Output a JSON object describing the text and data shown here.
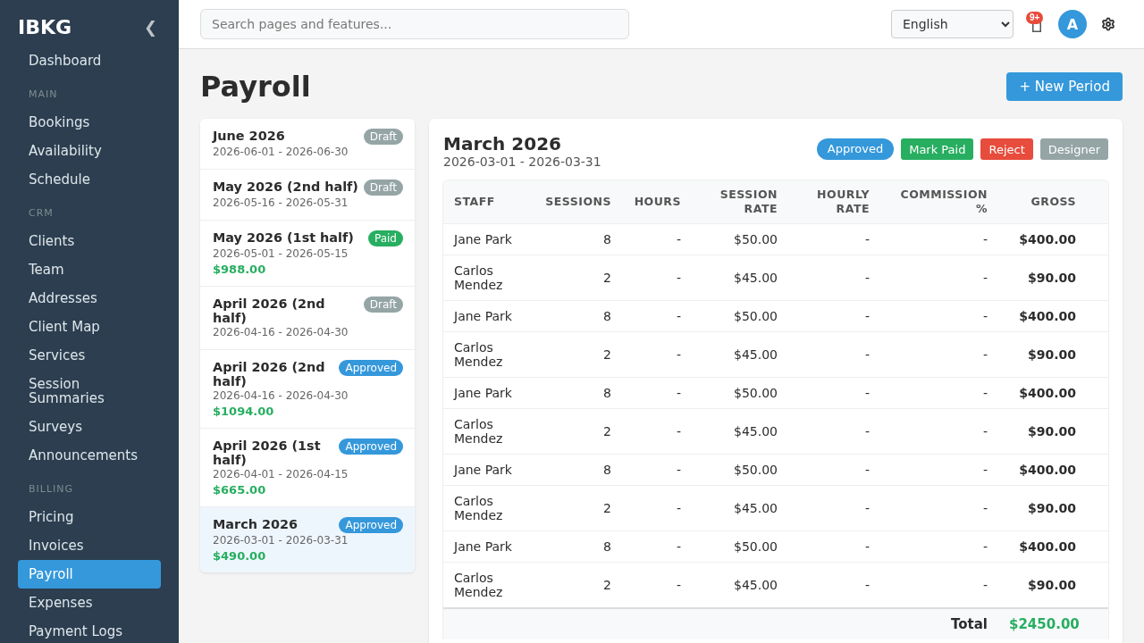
{
  "sidebar": {
    "logo": "IBKG",
    "collapse": "❮",
    "items": [
      {
        "kind": "link",
        "label": "Dashboard",
        "selected": false
      },
      {
        "kind": "section",
        "label": "MAIN"
      },
      {
        "kind": "link",
        "label": "Bookings",
        "selected": false
      },
      {
        "kind": "link",
        "label": "Availability",
        "selected": false
      },
      {
        "kind": "link",
        "label": "Schedule",
        "selected": false
      },
      {
        "kind": "section",
        "label": "CRM"
      },
      {
        "kind": "link",
        "label": "Clients",
        "selected": false
      },
      {
        "kind": "link",
        "label": "Team",
        "selected": false
      },
      {
        "kind": "link",
        "label": "Addresses",
        "selected": false
      },
      {
        "kind": "link",
        "label": "Client Map",
        "selected": false
      },
      {
        "kind": "link",
        "label": "Services",
        "selected": false
      },
      {
        "kind": "link",
        "label": "Session Summaries",
        "selected": false
      },
      {
        "kind": "link",
        "label": "Surveys",
        "selected": false
      },
      {
        "kind": "link",
        "label": "Announcements",
        "selected": false
      },
      {
        "kind": "section",
        "label": "BILLING"
      },
      {
        "kind": "link",
        "label": "Pricing",
        "selected": false
      },
      {
        "kind": "link",
        "label": "Invoices",
        "selected": false
      },
      {
        "kind": "link",
        "label": "Payroll",
        "selected": true
      },
      {
        "kind": "link",
        "label": "Expenses",
        "selected": false
      },
      {
        "kind": "link",
        "label": "Payment Logs",
        "selected": false
      }
    ]
  },
  "topbar": {
    "search": {
      "placeholder": "Search pages and features..."
    },
    "language": "English",
    "notifications": "9+",
    "avatar": "A"
  },
  "page": {
    "title": "Payroll",
    "new_button": "+ New Period"
  },
  "periods": [
    {
      "title": "June 2026",
      "dates": "2026-06-01 - 2026-06-30",
      "badge": {
        "label": "Draft",
        "color": "#95a5a6"
      },
      "selected": false
    },
    {
      "title": "May 2026 (2nd half)",
      "dates": "2026-05-16 - 2026-05-31",
      "badge": {
        "label": "Draft",
        "color": "#95a5a6"
      },
      "selected": false
    },
    {
      "title": "May 2026 (1st half)",
      "dates": "2026-05-01 - 2026-05-15",
      "badge": {
        "label": "Paid",
        "color": "#27ae60"
      },
      "amount": "$988.00",
      "selected": false
    },
    {
      "title": "April 2026 (2nd half)",
      "dates": "2026-04-16 - 2026-04-30",
      "badge": {
        "label": "Draft",
        "color": "#95a5a6"
      },
      "selected": false
    },
    {
      "title": "April 2026 (2nd half)",
      "dates": "2026-04-16 - 2026-04-30",
      "badge": {
        "label": "Approved",
        "color": "#3498db"
      },
      "amount": "$1094.00",
      "selected": false
    },
    {
      "title": "April 2026 (1st half)",
      "dates": "2026-04-01 - 2026-04-15",
      "badge": {
        "label": "Approved",
        "color": "#3498db"
      },
      "amount": "$665.00",
      "selected": false
    },
    {
      "title": "March 2026",
      "dates": "2026-03-01 - 2026-03-31",
      "badge": {
        "label": "Approved",
        "color": "#3498db"
      },
      "amount": "$490.00",
      "selected": true
    }
  ],
  "detail": {
    "title": "March 2026",
    "dates": "2026-03-01 - 2026-03-31",
    "badge": {
      "label": "Approved",
      "color": "#3498db"
    },
    "actions": [
      {
        "label": "Mark Paid",
        "kind": "success"
      },
      {
        "label": "Reject",
        "kind": "danger"
      },
      {
        "label": "Designer",
        "kind": "secondary"
      }
    ],
    "table": {
      "columns": [
        "STAFF",
        "SESSIONS",
        "HOURS",
        "SESSION RATE",
        "HOURLY RATE",
        "COMMISSION %",
        "GROSS"
      ],
      "rows": [
        [
          "Jane Park",
          "8",
          "-",
          "$50.00",
          "-",
          "-",
          "$400.00"
        ],
        [
          "Carlos Mendez",
          "2",
          "-",
          "$45.00",
          "-",
          "-",
          "$90.00"
        ],
        [
          "Jane Park",
          "8",
          "-",
          "$50.00",
          "-",
          "-",
          "$400.00"
        ],
        [
          "Carlos Mendez",
          "2",
          "-",
          "$45.00",
          "-",
          "-",
          "$90.00"
        ],
        [
          "Jane Park",
          "8",
          "-",
          "$50.00",
          "-",
          "-",
          "$400.00"
        ],
        [
          "Carlos Mendez",
          "2",
          "-",
          "$45.00",
          "-",
          "-",
          "$90.00"
        ],
        [
          "Jane Park",
          "8",
          "-",
          "$50.00",
          "-",
          "-",
          "$400.00"
        ],
        [
          "Carlos Mendez",
          "2",
          "-",
          "$45.00",
          "-",
          "-",
          "$90.00"
        ],
        [
          "Jane Park",
          "8",
          "-",
          "$50.00",
          "-",
          "-",
          "$400.00"
        ],
        [
          "Carlos Mendez",
          "2",
          "-",
          "$45.00",
          "-",
          "-",
          "$90.00"
        ]
      ],
      "total": {
        "label": "Total",
        "value": "$2450.00"
      }
    }
  }
}
